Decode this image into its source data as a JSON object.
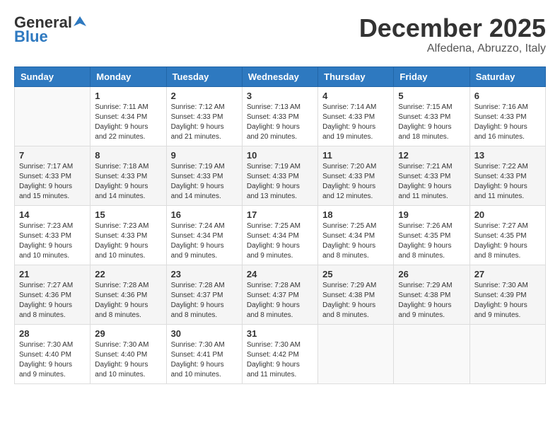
{
  "header": {
    "logo_general": "General",
    "logo_blue": "Blue",
    "month": "December 2025",
    "location": "Alfedena, Abruzzo, Italy"
  },
  "weekdays": [
    "Sunday",
    "Monday",
    "Tuesday",
    "Wednesday",
    "Thursday",
    "Friday",
    "Saturday"
  ],
  "weeks": [
    [
      {
        "day": "",
        "info": ""
      },
      {
        "day": "1",
        "info": "Sunrise: 7:11 AM\nSunset: 4:34 PM\nDaylight: 9 hours\nand 22 minutes."
      },
      {
        "day": "2",
        "info": "Sunrise: 7:12 AM\nSunset: 4:33 PM\nDaylight: 9 hours\nand 21 minutes."
      },
      {
        "day": "3",
        "info": "Sunrise: 7:13 AM\nSunset: 4:33 PM\nDaylight: 9 hours\nand 20 minutes."
      },
      {
        "day": "4",
        "info": "Sunrise: 7:14 AM\nSunset: 4:33 PM\nDaylight: 9 hours\nand 19 minutes."
      },
      {
        "day": "5",
        "info": "Sunrise: 7:15 AM\nSunset: 4:33 PM\nDaylight: 9 hours\nand 18 minutes."
      },
      {
        "day": "6",
        "info": "Sunrise: 7:16 AM\nSunset: 4:33 PM\nDaylight: 9 hours\nand 16 minutes."
      }
    ],
    [
      {
        "day": "7",
        "info": "Sunrise: 7:17 AM\nSunset: 4:33 PM\nDaylight: 9 hours\nand 15 minutes."
      },
      {
        "day": "8",
        "info": "Sunrise: 7:18 AM\nSunset: 4:33 PM\nDaylight: 9 hours\nand 14 minutes."
      },
      {
        "day": "9",
        "info": "Sunrise: 7:19 AM\nSunset: 4:33 PM\nDaylight: 9 hours\nand 14 minutes."
      },
      {
        "day": "10",
        "info": "Sunrise: 7:19 AM\nSunset: 4:33 PM\nDaylight: 9 hours\nand 13 minutes."
      },
      {
        "day": "11",
        "info": "Sunrise: 7:20 AM\nSunset: 4:33 PM\nDaylight: 9 hours\nand 12 minutes."
      },
      {
        "day": "12",
        "info": "Sunrise: 7:21 AM\nSunset: 4:33 PM\nDaylight: 9 hours\nand 11 minutes."
      },
      {
        "day": "13",
        "info": "Sunrise: 7:22 AM\nSunset: 4:33 PM\nDaylight: 9 hours\nand 11 minutes."
      }
    ],
    [
      {
        "day": "14",
        "info": "Sunrise: 7:23 AM\nSunset: 4:33 PM\nDaylight: 9 hours\nand 10 minutes."
      },
      {
        "day": "15",
        "info": "Sunrise: 7:23 AM\nSunset: 4:33 PM\nDaylight: 9 hours\nand 10 minutes."
      },
      {
        "day": "16",
        "info": "Sunrise: 7:24 AM\nSunset: 4:34 PM\nDaylight: 9 hours\nand 9 minutes."
      },
      {
        "day": "17",
        "info": "Sunrise: 7:25 AM\nSunset: 4:34 PM\nDaylight: 9 hours\nand 9 minutes."
      },
      {
        "day": "18",
        "info": "Sunrise: 7:25 AM\nSunset: 4:34 PM\nDaylight: 9 hours\nand 8 minutes."
      },
      {
        "day": "19",
        "info": "Sunrise: 7:26 AM\nSunset: 4:35 PM\nDaylight: 9 hours\nand 8 minutes."
      },
      {
        "day": "20",
        "info": "Sunrise: 7:27 AM\nSunset: 4:35 PM\nDaylight: 9 hours\nand 8 minutes."
      }
    ],
    [
      {
        "day": "21",
        "info": "Sunrise: 7:27 AM\nSunset: 4:36 PM\nDaylight: 9 hours\nand 8 minutes."
      },
      {
        "day": "22",
        "info": "Sunrise: 7:28 AM\nSunset: 4:36 PM\nDaylight: 9 hours\nand 8 minutes."
      },
      {
        "day": "23",
        "info": "Sunrise: 7:28 AM\nSunset: 4:37 PM\nDaylight: 9 hours\nand 8 minutes."
      },
      {
        "day": "24",
        "info": "Sunrise: 7:28 AM\nSunset: 4:37 PM\nDaylight: 9 hours\nand 8 minutes."
      },
      {
        "day": "25",
        "info": "Sunrise: 7:29 AM\nSunset: 4:38 PM\nDaylight: 9 hours\nand 8 minutes."
      },
      {
        "day": "26",
        "info": "Sunrise: 7:29 AM\nSunset: 4:38 PM\nDaylight: 9 hours\nand 9 minutes."
      },
      {
        "day": "27",
        "info": "Sunrise: 7:30 AM\nSunset: 4:39 PM\nDaylight: 9 hours\nand 9 minutes."
      }
    ],
    [
      {
        "day": "28",
        "info": "Sunrise: 7:30 AM\nSunset: 4:40 PM\nDaylight: 9 hours\nand 9 minutes."
      },
      {
        "day": "29",
        "info": "Sunrise: 7:30 AM\nSunset: 4:40 PM\nDaylight: 9 hours\nand 10 minutes."
      },
      {
        "day": "30",
        "info": "Sunrise: 7:30 AM\nSunset: 4:41 PM\nDaylight: 9 hours\nand 10 minutes."
      },
      {
        "day": "31",
        "info": "Sunrise: 7:30 AM\nSunset: 4:42 PM\nDaylight: 9 hours\nand 11 minutes."
      },
      {
        "day": "",
        "info": ""
      },
      {
        "day": "",
        "info": ""
      },
      {
        "day": "",
        "info": ""
      }
    ]
  ]
}
